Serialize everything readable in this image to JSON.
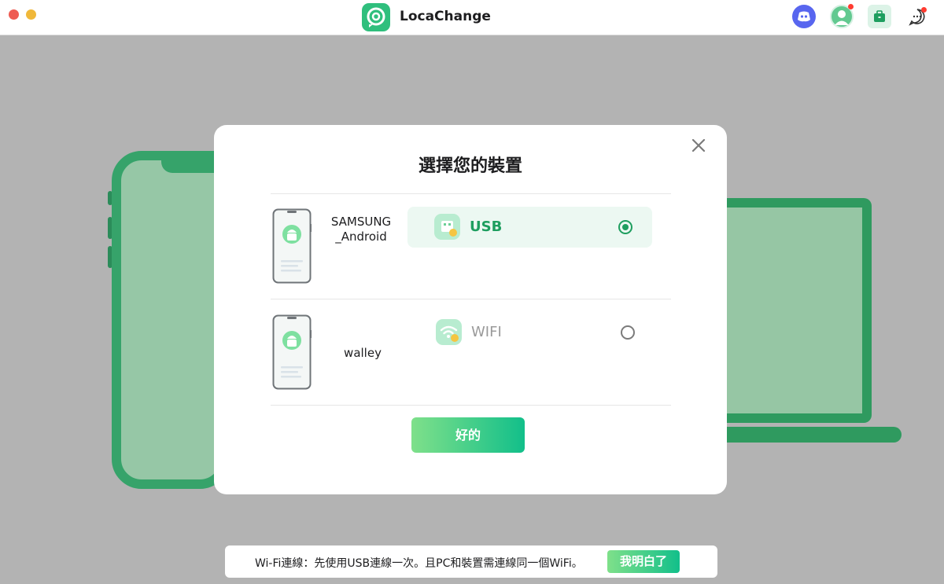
{
  "app": {
    "title": "LocaChange"
  },
  "titlebar": {
    "icons": [
      "discord-icon",
      "user-avatar-icon",
      "toolbox-icon",
      "chat-icon"
    ]
  },
  "dialog": {
    "title": "選擇您的裝置",
    "devices": [
      {
        "name_line1": "SAMSUNG",
        "name_line2": "_Android",
        "connection": "USB",
        "connection_icon": "usb-icon",
        "selected": true
      },
      {
        "name_line1": "walley",
        "connection": "WIFI",
        "connection_icon": "wifi-icon",
        "selected": false
      }
    ],
    "ok_label": "好的"
  },
  "toast": {
    "message": "Wi-Fi連線：先使用USB連線一次。且PC和裝置需連線同一個WiFi。",
    "button_label": "我明白了"
  },
  "colors": {
    "accent": "#1e9e5f",
    "button_gradient_start": "#7fe08a",
    "button_gradient_end": "#12bf8a",
    "active_row_bg": "#ecf8f2",
    "wifi_label": "#9a9a9a"
  }
}
